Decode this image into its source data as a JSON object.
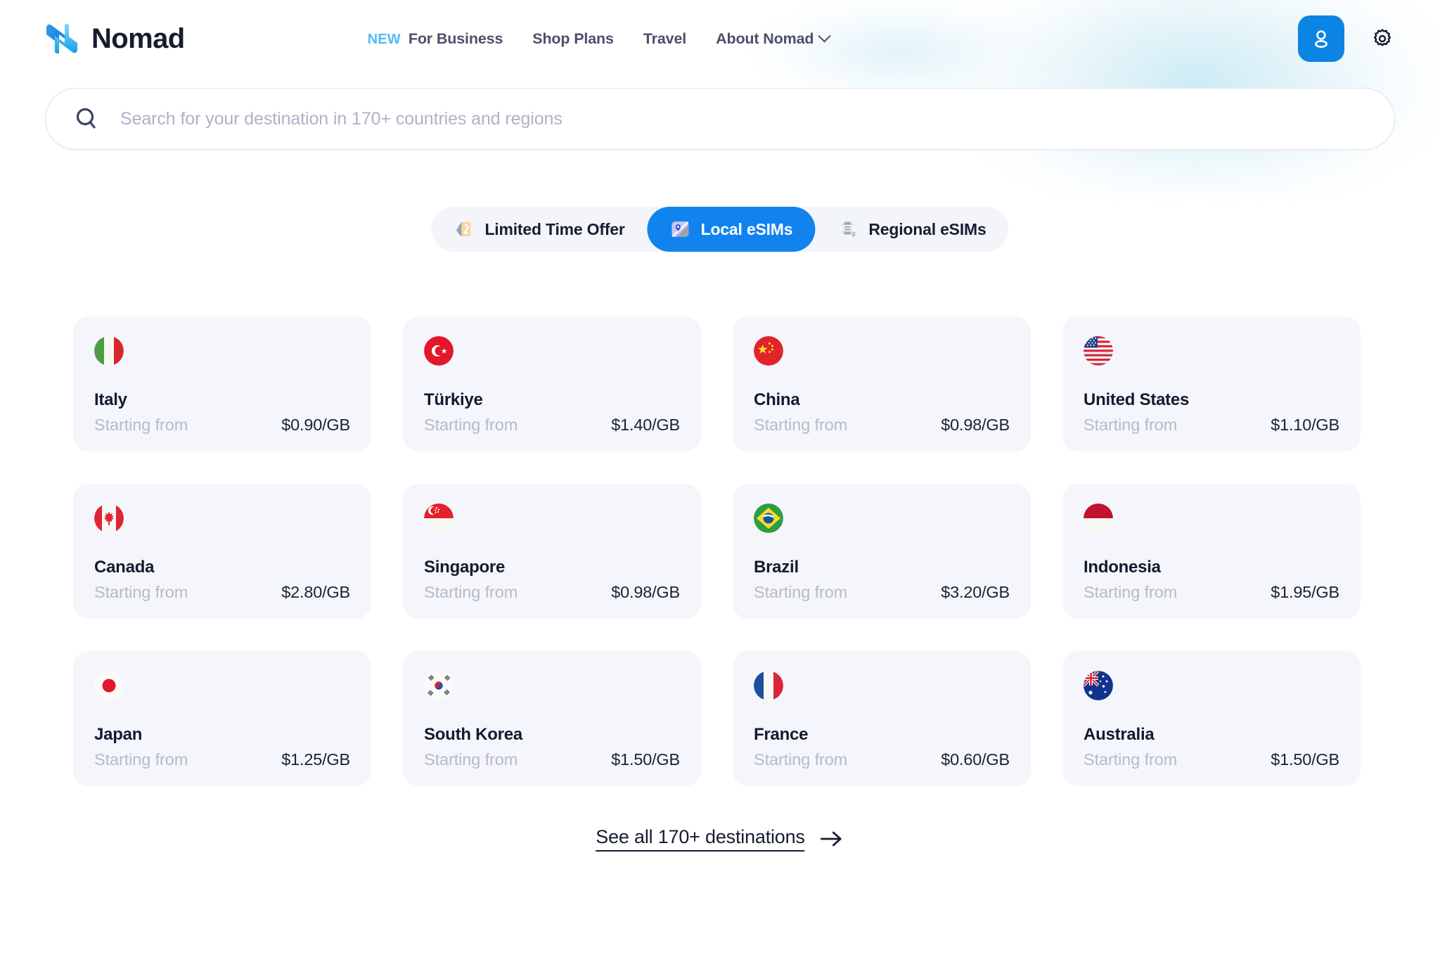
{
  "brand": {
    "name": "Nomad",
    "logo_icon": "nomad-logo-icon"
  },
  "nav": {
    "new_badge": "NEW",
    "items": [
      {
        "label": "For Business",
        "has_chevron": false
      },
      {
        "label": "Shop Plans",
        "has_chevron": false
      },
      {
        "label": "Travel",
        "has_chevron": false
      },
      {
        "label": "About Nomad",
        "has_chevron": true
      }
    ]
  },
  "header_right": {
    "account_icon": "user-icon",
    "settings_icon": "gear-icon",
    "accent_color": "#0b84e4"
  },
  "search": {
    "icon": "search-icon",
    "value": "",
    "placeholder": "Search for your destination in 170+ countries and regions"
  },
  "tabs": {
    "active_index": 1,
    "active_color": "#1183ef",
    "items": [
      {
        "label": "Limited Time Offer",
        "icon": "price-tag-icon"
      },
      {
        "label": "Local eSIMs",
        "icon": "map-pin-icon"
      },
      {
        "label": "Regional eSIMs",
        "icon": "globe-pin-icon"
      }
    ]
  },
  "destinations": {
    "starting_from_label": "Starting from",
    "cards": [
      {
        "country": "Italy",
        "price": "$0.90/GB",
        "flag": "flag-italy"
      },
      {
        "country": "Türkiye",
        "price": "$1.40/GB",
        "flag": "flag-turkiye"
      },
      {
        "country": "China",
        "price": "$0.98/GB",
        "flag": "flag-china"
      },
      {
        "country": "United States",
        "price": "$1.10/GB",
        "flag": "flag-united-states"
      },
      {
        "country": "Canada",
        "price": "$2.80/GB",
        "flag": "flag-canada"
      },
      {
        "country": "Singapore",
        "price": "$0.98/GB",
        "flag": "flag-singapore"
      },
      {
        "country": "Brazil",
        "price": "$3.20/GB",
        "flag": "flag-brazil"
      },
      {
        "country": "Indonesia",
        "price": "$1.95/GB",
        "flag": "flag-indonesia"
      },
      {
        "country": "Japan",
        "price": "$1.25/GB",
        "flag": "flag-japan"
      },
      {
        "country": "South Korea",
        "price": "$1.50/GB",
        "flag": "flag-south-korea"
      },
      {
        "country": "France",
        "price": "$0.60/GB",
        "flag": "flag-france"
      },
      {
        "country": "Australia",
        "price": "$1.50/GB",
        "flag": "flag-australia"
      }
    ]
  },
  "see_all": {
    "label": "See all 170+ destinations",
    "icon": "arrow-right-icon"
  }
}
